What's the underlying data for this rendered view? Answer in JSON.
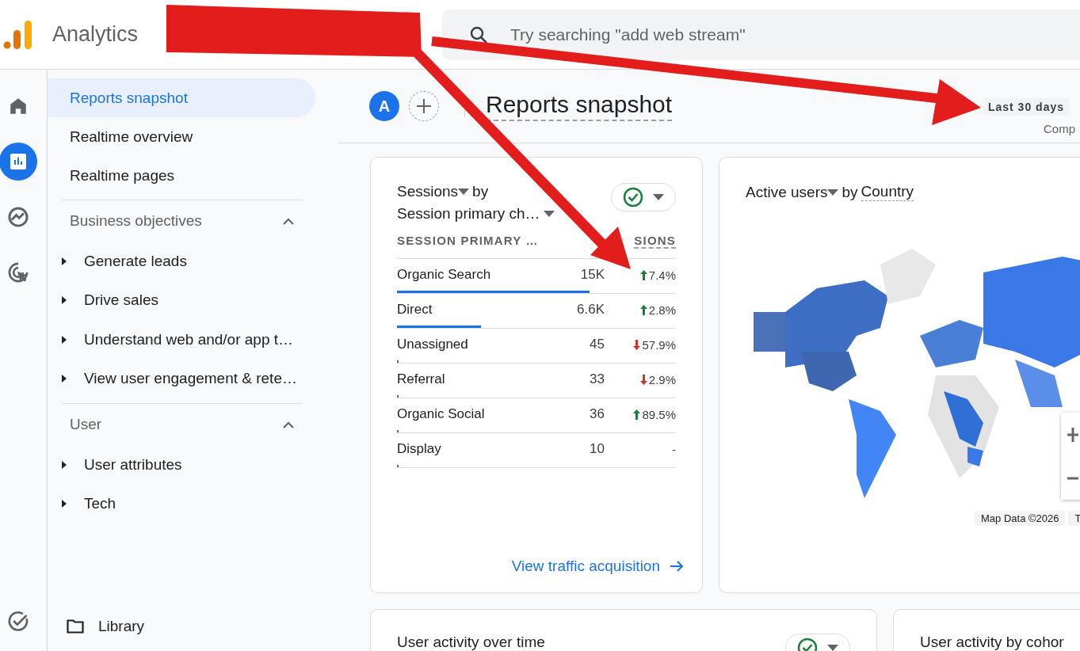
{
  "app": {
    "name": "Analytics"
  },
  "search": {
    "placeholder": "Try searching \"add web stream\""
  },
  "rail": [
    {
      "kind": "home",
      "selected": false
    },
    {
      "kind": "reports",
      "selected": true
    },
    {
      "kind": "explore",
      "selected": false
    },
    {
      "kind": "advertising",
      "selected": false
    }
  ],
  "rail_bottom": {
    "kind": "admin",
    "selected": false
  },
  "nav": {
    "items": [
      {
        "label": "Reports snapshot",
        "selected": true
      },
      {
        "label": "Realtime overview",
        "selected": false
      },
      {
        "label": "Realtime pages",
        "selected": false
      }
    ],
    "sections": [
      {
        "title": "Business objectives",
        "expanded": true,
        "items": [
          {
            "label": "Generate leads"
          },
          {
            "label": "Drive sales"
          },
          {
            "label": "Understand web and/or app t…"
          },
          {
            "label": "View user engagement & rete…"
          }
        ]
      },
      {
        "title": "User",
        "expanded": true,
        "items": [
          {
            "label": "User attributes"
          },
          {
            "label": "Tech"
          }
        ]
      }
    ],
    "library": "Library"
  },
  "header": {
    "avatar": "A",
    "title": "Reports snapshot",
    "date_range": "Last 30 days",
    "compare": "Comp"
  },
  "sessions_card": {
    "metric": "Sessions",
    "by": "by",
    "dimension": "Session primary ch…",
    "columns": [
      "SESSION PRIMARY …",
      "SIONS"
    ],
    "rows": [
      {
        "name": "Organic Search",
        "value": "15K",
        "change": "7.4%",
        "kind": "up",
        "level": 0.69
      },
      {
        "name": "Direct",
        "value": "6.6K",
        "change": "2.8%",
        "kind": "up",
        "level": 0.3
      },
      {
        "name": "Unassigned",
        "value": "45",
        "change": "57.9%",
        "kind": "down",
        "level": 0.005
      },
      {
        "name": "Referral",
        "value": "33",
        "change": "2.9%",
        "kind": "down",
        "level": 0.005
      },
      {
        "name": "Organic Social",
        "value": "36",
        "change": "89.5%",
        "kind": "up",
        "level": 0.005
      },
      {
        "name": "Display",
        "value": "10",
        "change": "-",
        "kind": "none",
        "level": 0.005
      }
    ],
    "link": "View traffic acquisition"
  },
  "map_card": {
    "metric": "Active users",
    "by": "by",
    "dimension": "Country",
    "attribution": "Map Data ©2026",
    "attribution_cut": "T"
  },
  "bottom_cards": [
    {
      "title": "User activity over time",
      "has_check": true
    },
    {
      "title": "User activity by cohor",
      "has_check": false
    }
  ]
}
